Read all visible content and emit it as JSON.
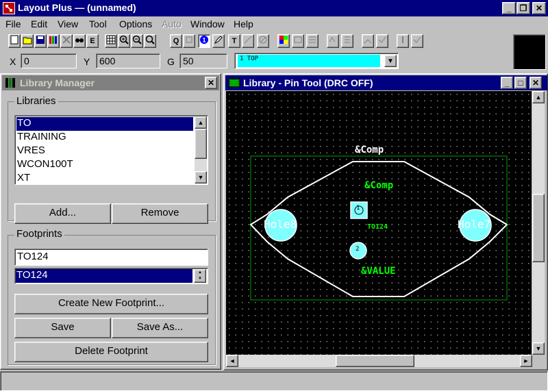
{
  "window": {
    "title": "Layout Plus — (unnamed)",
    "controls": [
      "_",
      "❐",
      "✕"
    ]
  },
  "menu": {
    "items": [
      {
        "label": "File",
        "enabled": true
      },
      {
        "label": "Edit",
        "enabled": true
      },
      {
        "label": "View",
        "enabled": true
      },
      {
        "label": "Tool",
        "enabled": true
      },
      {
        "label": "Options",
        "enabled": true
      },
      {
        "label": "Auto",
        "enabled": false
      },
      {
        "label": "Window",
        "enabled": true
      },
      {
        "label": "Help",
        "enabled": true
      }
    ]
  },
  "toolbar": {
    "e_label": "E",
    "q_label": "Q",
    "t_label": "T"
  },
  "coords": {
    "x_label": "X",
    "x_value": "0",
    "y_label": "Y",
    "y_value": "600",
    "g_label": "G",
    "g_value": "50",
    "layer": "1 TOP"
  },
  "library_manager": {
    "title": "Library Manager",
    "libraries_label": "Libraries",
    "libraries": [
      "TO",
      "TRAINING",
      "VRES",
      "WCON100T",
      "XT"
    ],
    "selected_library": "TO",
    "add_button": "Add...",
    "remove_button": "Remove",
    "footprints_label": "Footprints",
    "footprint_input": "TO124",
    "footprint_selected": "TO124",
    "create_button": "Create New Footprint...",
    "save_button": "Save",
    "save_as_button": "Save As...",
    "delete_button": "Delete Footprint"
  },
  "pin_tool": {
    "title": "Library - Pin Tool (DRC OFF)",
    "labels": {
      "comp_outer": "&Comp",
      "comp_inner": "&Comp",
      "part": "TO124",
      "value": "&VALUE",
      "hole_left": "Hole8",
      "hole_right": "Hole7",
      "pin1": "1",
      "pin2": "2"
    },
    "colors": {
      "background": "#000000",
      "outline": "#ffffff",
      "label": "#00ff00",
      "pad": "#80ffff",
      "boundary": "#00a000"
    }
  }
}
